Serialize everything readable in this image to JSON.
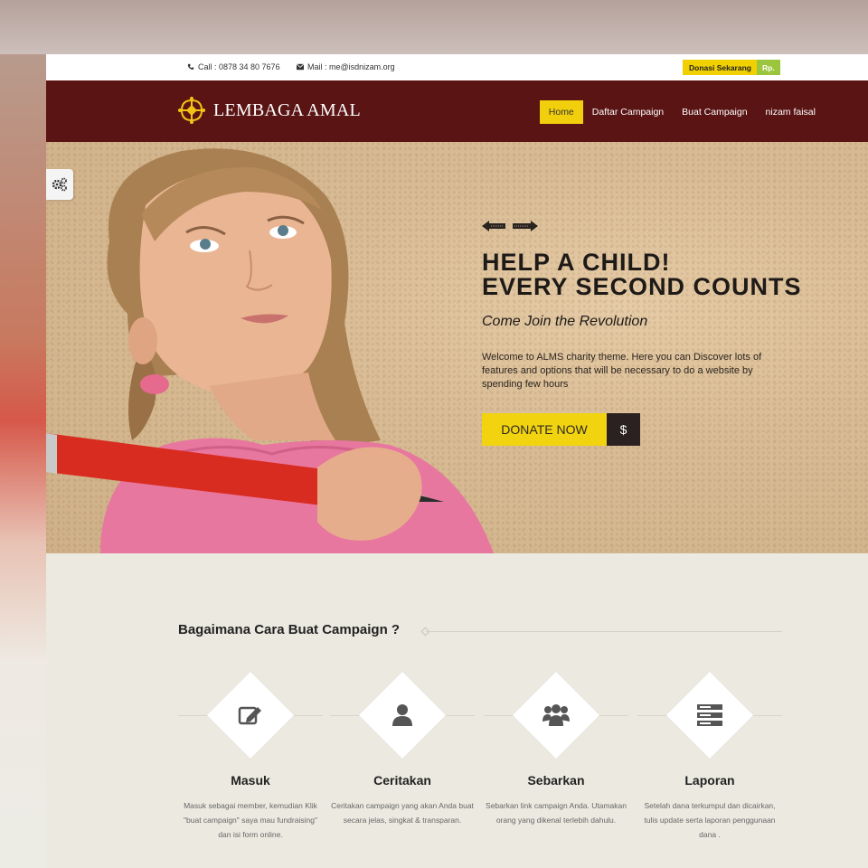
{
  "topbar": {
    "phone": "Call : 0878 34 80 7676",
    "mail": "Mail : me@isdnizam.org",
    "donasi_label": "Donasi Sekarang",
    "donasi_currency": "Rp."
  },
  "header": {
    "logo_text": "LEMBAGA AMAL",
    "nav": [
      {
        "label": "Home",
        "active": true
      },
      {
        "label": "Daftar Campaign"
      },
      {
        "label": "Buat Campaign"
      },
      {
        "label": "nizam faisal"
      }
    ]
  },
  "hero": {
    "title_line1": "HELP A CHILD!",
    "title_line2": "EVERY SECOND COUNTS",
    "subtitle": "Come Join the Revolution",
    "description": "Welcome to ALMS charity theme. Here you can Discover lots of features and options that will be necessary to do a website by spending few hours",
    "donate_label": "DONATE NOW",
    "donate_currency": "$"
  },
  "how": {
    "title": "Bagaimana Cara Buat Campaign ?",
    "steps": [
      {
        "icon": "edit-icon",
        "name": "Masuk",
        "desc": "Masuk sebagai member, kemudian Klik \"buat campaign\" saya mau fundraising\" dan isi form online."
      },
      {
        "icon": "user-icon",
        "name": "Ceritakan",
        "desc": "Ceritakan campaign yang akan Anda buat secara jelas, singkat & transparan."
      },
      {
        "icon": "users-icon",
        "name": "Sebarkan",
        "desc": "Sebarkan link campaign Anda. Utamakan orang yang dikenal terlebih dahulu."
      },
      {
        "icon": "server-icon",
        "name": "Laporan",
        "desc": "Setelah dana terkumpul dan dicairkan, tulis update serta laporan penggunaan dana ."
      }
    ]
  },
  "colors": {
    "header_bg": "#5a1414",
    "accent_yellow": "#f2d30f",
    "accent_green": "#9bc53d",
    "section_bg": "#ebe9e0"
  }
}
